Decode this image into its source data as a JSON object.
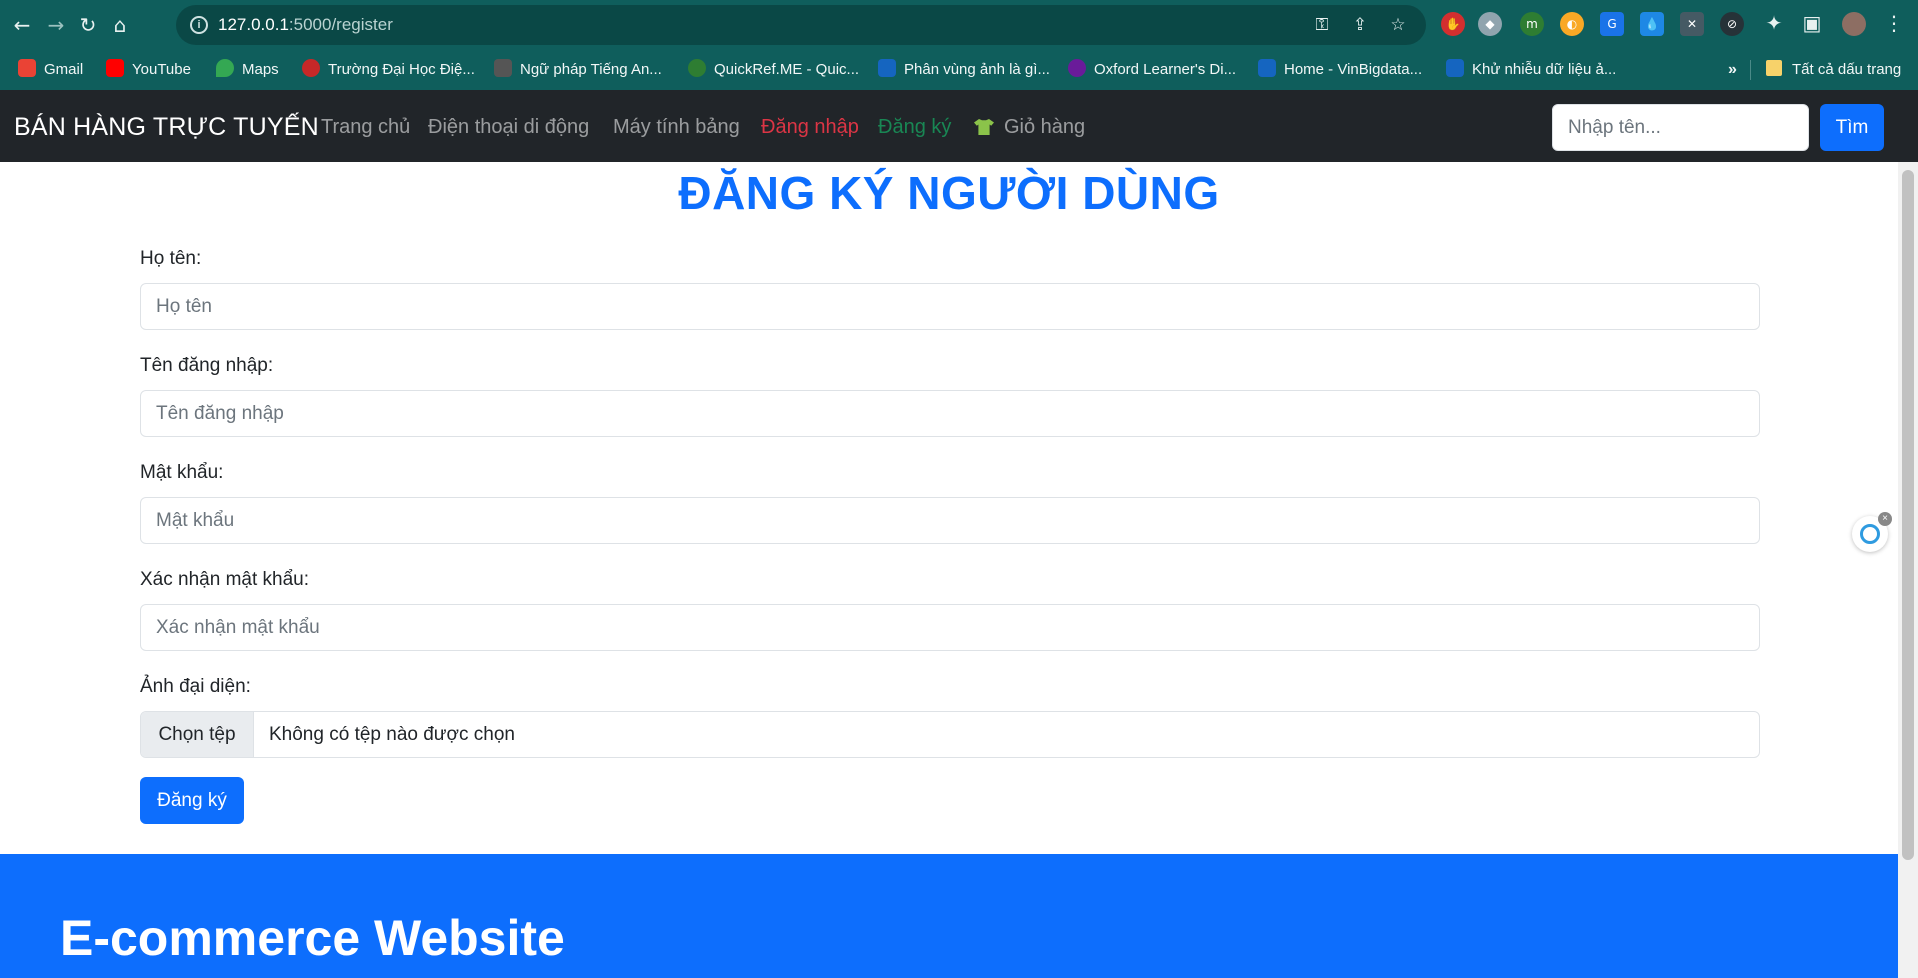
{
  "browser": {
    "url_host": "127.0.0.1",
    "url_rest": ":5000/register",
    "bookmarks": [
      {
        "label": "Gmail",
        "color": "#ea4335"
      },
      {
        "label": "YouTube",
        "color": "#ff0000"
      },
      {
        "label": "Maps",
        "color": "#34a853"
      },
      {
        "label": "Trường Đại Học Điệ...",
        "color": "#c62828"
      },
      {
        "label": "Ngữ pháp Tiếng An...",
        "color": "#555555"
      },
      {
        "label": "QuickRef.ME - Quic...",
        "color": "#2e7d32"
      },
      {
        "label": "Phân vùng ảnh là gì...",
        "color": "#1565c0"
      },
      {
        "label": "Oxford Learner's Di...",
        "color": "#6a1b9a"
      },
      {
        "label": "Home - VinBigdata...",
        "color": "#1565c0"
      },
      {
        "label": "Khử nhiễu dữ liệu ả...",
        "color": "#1565c0"
      }
    ],
    "bookmarks_more": "»",
    "all_bookmarks": "Tất cả dấu trang"
  },
  "navbar": {
    "brand": "BÁN HÀNG TRỰC TUYẾN",
    "links": [
      {
        "label": "Trang chủ"
      },
      {
        "label": "Điện thoại di động"
      },
      {
        "label": "Máy tính bảng"
      },
      {
        "label": "Đăng nhập"
      },
      {
        "label": "Đăng ký"
      }
    ],
    "cart": "Giỏ hàng",
    "search_placeholder": "Nhập tên...",
    "search_button": "Tìm"
  },
  "page": {
    "title": "ĐĂNG KÝ NGƯỜI DÙNG"
  },
  "form": {
    "name_label": "Họ tên:",
    "name_placeholder": "Họ tên",
    "username_label": "Tên đăng nhập:",
    "username_placeholder": "Tên đăng nhập",
    "password_label": "Mật khẩu:",
    "password_placeholder": "Mật khẩu",
    "confirm_label": "Xác nhận mật khẩu:",
    "confirm_placeholder": "Xác nhận mật khẩu",
    "avatar_label": "Ảnh đại diện:",
    "file_button": "Chọn tệp",
    "file_status": "Không có tệp nào được chọn",
    "submit": "Đăng ký"
  },
  "footer": {
    "title": "E-commerce Website"
  },
  "colors": {
    "chrome": "#0f5e5c",
    "navbar": "#212529",
    "primary": "#0d6efd",
    "danger": "#dc3545",
    "success": "#198754"
  }
}
